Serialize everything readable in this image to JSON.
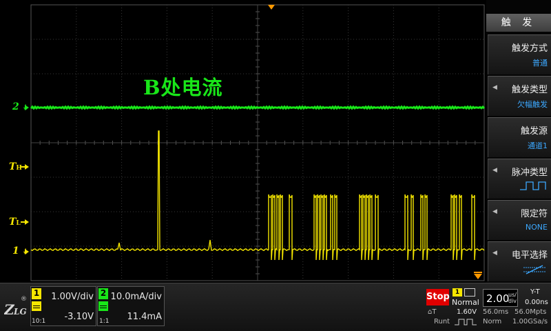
{
  "screen": {
    "annotation": "B处电流",
    "markers": {
      "ch2_ground": "2",
      "trig_high": "T",
      "trig_high_sub": "H",
      "trig_low": "T",
      "trig_low_sub": "L",
      "ch1_ground": "1"
    },
    "colors": {
      "ch1": "#f5e600",
      "ch2": "#19e619",
      "grid": "#3a3a3a",
      "trigger_marker": "#ff9900"
    }
  },
  "menu": {
    "title": "触 发",
    "items": [
      {
        "label": "触发方式",
        "value": "普通"
      },
      {
        "label": "触发类型",
        "value": "欠幅触发"
      },
      {
        "label": "触发源",
        "value": "通道1"
      },
      {
        "label": "脉冲类型",
        "icon": "positive-pulse-icon"
      },
      {
        "label": "限定符",
        "value": "NONE"
      },
      {
        "label": "电平选择",
        "icon": "dual-level-slope-icon"
      }
    ]
  },
  "status": {
    "reg": "®",
    "ch1": {
      "num": "1",
      "scale": "1.00V/div",
      "offset": "-3.10V",
      "probe": "10:1"
    },
    "ch2": {
      "num": "2",
      "scale": "10.0mA/div",
      "offset": "11.4mA",
      "probe": "1:1"
    },
    "run_state": "Stop",
    "trig_ch": "1",
    "trig_mode": "Normal",
    "trig_slope_label": "⌂T",
    "trig_level": "1.60V",
    "trig_type": "Runt",
    "timebase": "2.00",
    "timebase_unit_top": "us/",
    "timebase_unit_bottom": "div",
    "delay_time": "56.0ms",
    "mem_depth": "56.0Mpts",
    "acq_mode": "Norm",
    "sample_rate": "1.00GSa/s",
    "display_mode": "Y-T",
    "h_offset": "0.00ns"
  }
}
